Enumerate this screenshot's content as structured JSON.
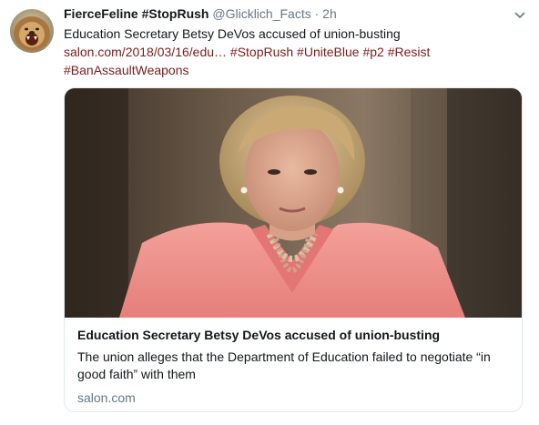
{
  "tweet": {
    "display_name": "FierceFeline #StopRush",
    "handle": "@Glicklich_Facts",
    "separator": "·",
    "time": "2h",
    "text": "Education Secretary Betsy DeVos accused of union-busting",
    "links_line1": "salon.com/2018/03/16/edu… #StopRush #UniteBlue #p2 #Resist",
    "links_line2": "#BanAssaultWeapons",
    "avatar_icon": "lion-avatar",
    "caret_icon": "chevron-down-icon"
  },
  "card": {
    "title": "Education Secretary Betsy DeVos accused of union-busting",
    "description": "The union alleges that the Department of Education failed to negotiate “in good faith” with them",
    "domain": "salon.com",
    "image_alt": "photo-of-woman-in-pink-jacket"
  },
  "colors": {
    "text": "#14171a",
    "secondary": "#657786",
    "link": "#7b1c1c",
    "border": "#e1e8ed"
  }
}
